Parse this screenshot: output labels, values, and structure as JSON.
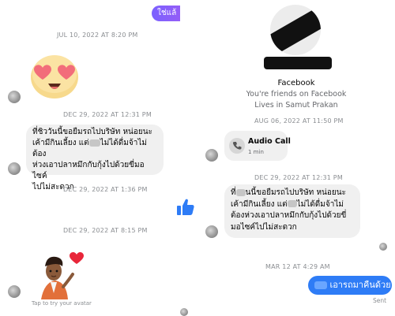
{
  "left": {
    "top_bubble_text": "ใช่แล้",
    "timestamps": [
      "JUL 10, 2022 AT 8:20 PM",
      "DEC 29, 2022 AT 12:31 PM",
      "DEC 29, 2022 AT 1:36 PM",
      "DEC 29, 2022 AT 8:15 PM"
    ],
    "message_lines": [
      "ที่ชิววันนี้ขอยืมรถไปบริษัท หน่อยนะ",
      "เค้ามีกินเลี้ยง แต่",
      "ไม่ได้ดื่มจ้าไม่ต้อง",
      "ห่วงเอาปลาหมึกกับกุ้งไปด้วยขี่มอไซค์",
      "ไปไม่สะดวก"
    ],
    "avatar_hint": "Tap to try your avatar"
  },
  "right": {
    "profile_name": "Facebook",
    "friends_text": "You're friends on Facebook",
    "lives_text": "Lives in Samut Prakan",
    "timestamps": [
      "AUG 06, 2022 AT 11:50 PM",
      "DEC 29, 2022 AT 12:31 PM",
      "MAR 12 AT 4:29 AM"
    ],
    "call": {
      "title": "Audio Call",
      "duration": "1 min",
      "icon": "phone-icon"
    },
    "message_lines": [
      "ที่",
      "นนี้ขอยืมรถไปบริษัท หน่อยนะ",
      "เค้ามีกินเลี้ยง แต่",
      "ไม่ได้ดื่มจ้าไม่",
      "ต้องห่วงเอาปลาหมึกกับกุ้งไปด้วยขี่",
      "มอไซค์ไปไม่สะดวก"
    ],
    "reply_text": "เอารถมาคืนด้วย",
    "sent_label": "Sent",
    "reaction_icon": "thumbs-up-icon"
  },
  "colors": {
    "accent_blue": "#2e7cf6",
    "purple": "#8b5cf6",
    "bubble_gray": "#f0f0f0",
    "timestamp_gray": "#8a8d91"
  }
}
